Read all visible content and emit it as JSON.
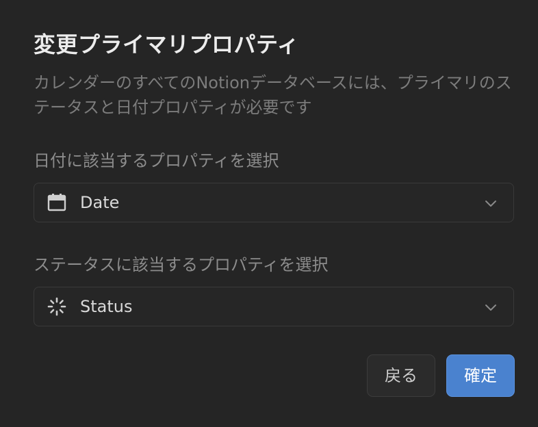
{
  "dialog": {
    "title": "変更プライマリプロパティ",
    "description": "カレンダーのすべてのNotionデータベースには、プライマリのステータスと日付プロパティが必要です"
  },
  "date_property": {
    "label": "日付に該当するプロパティを選択",
    "value": "Date",
    "icon": "calendar-icon"
  },
  "status_property": {
    "label": "ステータスに該当するプロパティを選択",
    "value": "Status",
    "icon": "status-spinner-icon"
  },
  "buttons": {
    "back_label": "戻る",
    "confirm_label": "確定"
  },
  "colors": {
    "background": "#252525",
    "primary_button": "#4a82cf"
  }
}
